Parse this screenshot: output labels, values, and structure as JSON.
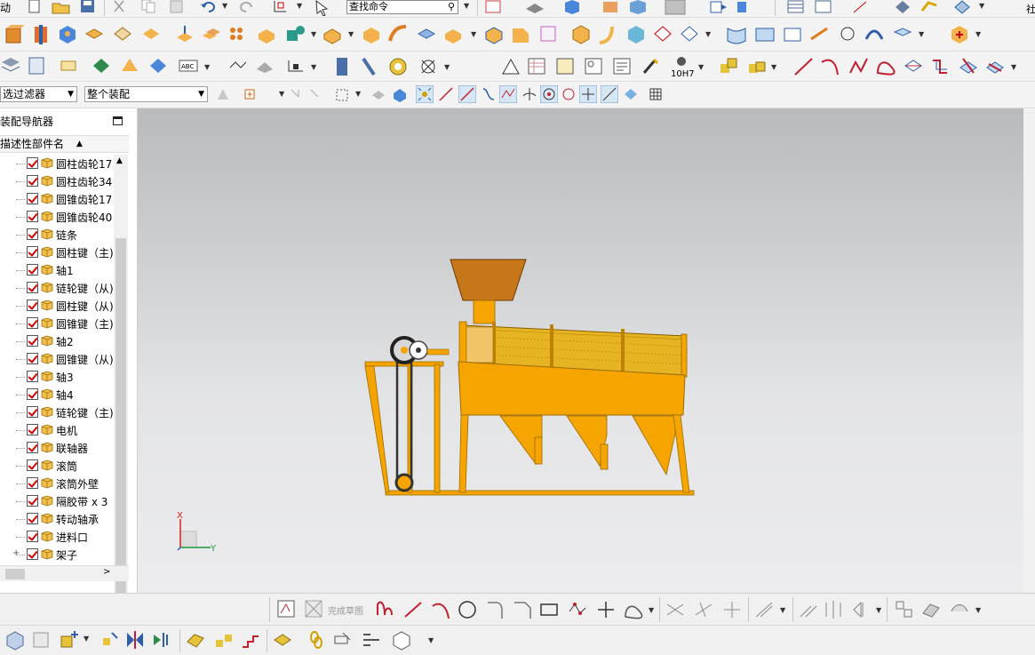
{
  "toolbar": {
    "cut_label": "动",
    "find_command_placeholder": "查找命令",
    "filter_select": "选过滤器",
    "assembly_select": "整个装配",
    "tolerance_label": "10H7"
  },
  "navigator": {
    "title": "装配导航器",
    "column_header": "描述性部件名",
    "items": [
      {
        "label": "圆柱齿轮17"
      },
      {
        "label": "圆柱齿轮34"
      },
      {
        "label": "圆锥齿轮17"
      },
      {
        "label": "圆锥齿轮40"
      },
      {
        "label": "链条"
      },
      {
        "label": "圆柱键（主)"
      },
      {
        "label": "轴1"
      },
      {
        "label": "链轮键（从)"
      },
      {
        "label": "圆柱键（从)"
      },
      {
        "label": "圆锥键（主)"
      },
      {
        "label": "轴2"
      },
      {
        "label": "圆锥键（从)"
      },
      {
        "label": "轴3"
      },
      {
        "label": "轴4"
      },
      {
        "label": "链轮键（主)"
      },
      {
        "label": "电机"
      },
      {
        "label": "联轴器"
      },
      {
        "label": "滚筒"
      },
      {
        "label": "滚筒外壁"
      },
      {
        "label": "隔胶带 x 3"
      },
      {
        "label": "转动轴承"
      },
      {
        "label": "进料口"
      },
      {
        "label": "架子"
      }
    ]
  },
  "sketch_toolbar": {
    "finish_sketch_label": "完成草图"
  },
  "axes": {
    "x": "X",
    "y": "Y"
  },
  "colors": {
    "model_orange": "#f6a500",
    "hopper_brown": "#c8761a",
    "checkbox_red": "#d00000",
    "viewport_top": "#b9babc",
    "viewport_bottom": "#ececee"
  },
  "edge": {
    "right_char": "社"
  }
}
